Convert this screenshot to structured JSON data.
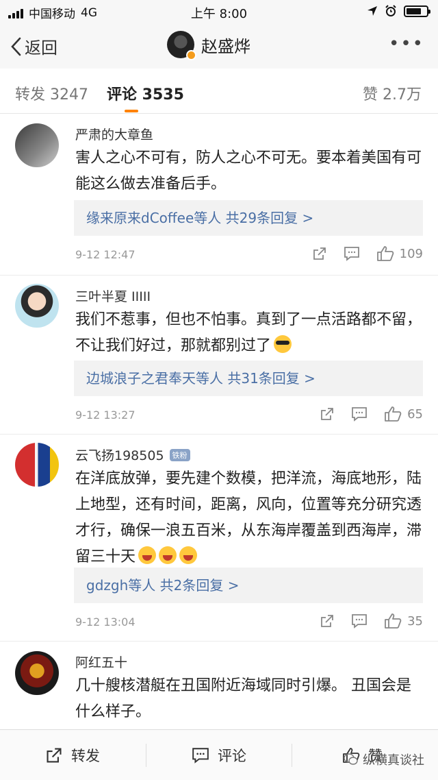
{
  "status_bar": {
    "carrier": "中国移动",
    "network": "4G",
    "time": "上午 8:00",
    "battery_level": 0.75
  },
  "nav": {
    "back_label": "返回",
    "title": "赵盛烨",
    "more_icon": "more-icon"
  },
  "tabs": {
    "repost": "转发 3247",
    "comment": "评论 3535",
    "like": "赞 2.7万"
  },
  "colors": {
    "accent": "#ff8200",
    "link": "#4a6fa5"
  },
  "comments": [
    {
      "name": "严肃的大章鱼",
      "text": "害人之心不可有，防人之心不可无。要本着美国有可能这么做去准备后手。",
      "reply_users": "缘来原来dCoffee",
      "reply_mid": "等人 ",
      "reply_count": "共29条回复 >",
      "time": "9-12 12:47",
      "likes": "109"
    },
    {
      "name": "三叶半夏 IIIII",
      "text": "我们不惹事，但也不怕事。真到了一点活路都不留，不让我们好过，那就都别过了",
      "reply_users": "边城浪子之君奉天",
      "reply_mid": "等人 ",
      "reply_count": "共31条回复 >",
      "time": "9-12 13:27",
      "likes": "65"
    },
    {
      "name": "云飞扬198505",
      "badge": "铁粉",
      "text": "在洋底放弹，要先建个数模，把洋流，海底地形，陆上地型，还有时间，距离，风向，位置等充分研究透才行，确保一浪五百米，从东海岸覆盖到西海岸，滞留三十天",
      "reply_users": "gdzgh",
      "reply_mid": "等人 ",
      "reply_count": "共2条回复 >",
      "time": "9-12 13:04",
      "likes": "35"
    },
    {
      "name": "阿红五十",
      "text": "几十艘核潜艇在丑国附近海域同时引爆。 丑国会是什么样子。"
    }
  ],
  "bottom_bar": {
    "repost": "转发",
    "comment": "评论",
    "like": "赞",
    "watermark": "纵横真谈社"
  }
}
